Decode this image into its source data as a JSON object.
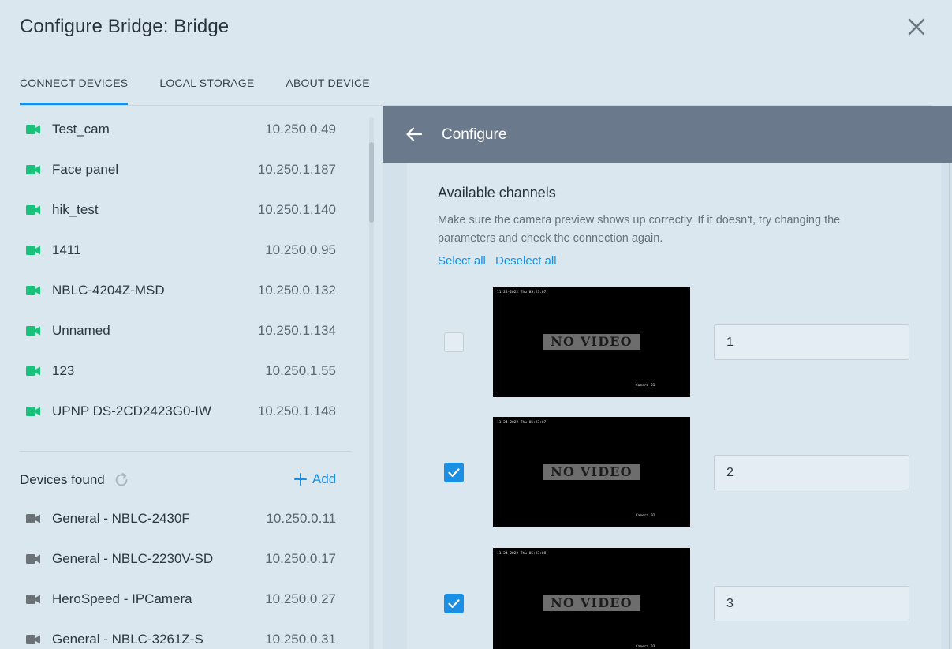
{
  "dialog": {
    "title": "Configure Bridge: Bridge"
  },
  "tabs": [
    {
      "label": "CONNECT DEVICES",
      "active": true
    },
    {
      "label": "LOCAL STORAGE",
      "active": false
    },
    {
      "label": "ABOUT DEVICE",
      "active": false
    }
  ],
  "connected_devices": [
    {
      "name": "Test_cam",
      "ip": "10.250.0.49"
    },
    {
      "name": "Face panel",
      "ip": "10.250.1.187"
    },
    {
      "name": "hik_test",
      "ip": "10.250.1.140"
    },
    {
      "name": "1411",
      "ip": "10.250.0.95"
    },
    {
      "name": "NBLC-4204Z-MSD",
      "ip": "10.250.0.132"
    },
    {
      "name": "Unnamed",
      "ip": "10.250.1.134"
    },
    {
      "name": "123",
      "ip": "10.250.1.55"
    },
    {
      "name": "UPNP DS-2CD2423G0-IW",
      "ip": "10.250.1.148"
    }
  ],
  "found_section": {
    "title": "Devices found",
    "add_label": "Add"
  },
  "found_devices": [
    {
      "name": "General - NBLC-2430F",
      "ip": "10.250.0.11"
    },
    {
      "name": "General - NBLC-2230V-SD",
      "ip": "10.250.0.17"
    },
    {
      "name": "HeroSpeed - IPCamera",
      "ip": "10.250.0.27"
    },
    {
      "name": "General - NBLC-3261Z-S",
      "ip": "10.250.0.31"
    }
  ],
  "configure": {
    "title": "Configure",
    "channels_title": "Available channels",
    "description": "Make sure the camera preview shows up correctly. If it doesn't, try changing the parameters and check the connection again.",
    "select_all": "Select all",
    "deselect_all": "Deselect all",
    "channels": [
      {
        "checked": false,
        "value": "1",
        "timestamp": "11-24-2022 Thu 05:23:07",
        "overlay": "NO VIDEO",
        "camera_label": "Camera 01"
      },
      {
        "checked": true,
        "value": "2",
        "timestamp": "11-24-2022 Thu 05:23:07",
        "overlay": "NO VIDEO",
        "camera_label": "Camera 02"
      },
      {
        "checked": true,
        "value": "3",
        "timestamp": "11-24-2022 Thu 05:23:08",
        "overlay": "NO VIDEO",
        "camera_label": "Camera 03"
      }
    ]
  },
  "colors": {
    "accent": "#1a8fe3",
    "online_camera": "#18c27a",
    "offline_camera": "#6b7379",
    "header_bar": "#6a798b",
    "background": "#dae7ef"
  },
  "icons": {
    "close": "close-icon",
    "back": "arrow-left-icon",
    "camera": "video-camera-icon",
    "refresh": "refresh-icon",
    "add": "plus-icon",
    "check": "checkmark-icon"
  }
}
